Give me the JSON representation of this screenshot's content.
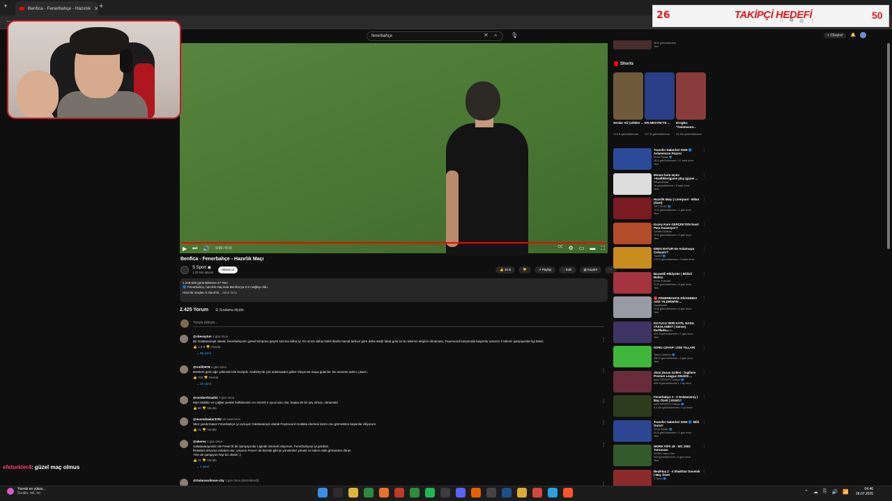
{
  "browser": {
    "tab_title": "Benfica - Fenerbahçe - Hazırlık",
    "tab_close": "✕",
    "new_tab": "+",
    "back": "←"
  },
  "youtube_header": {
    "search_value": "fenerbahçe",
    "clear_icon": "✕",
    "search_icon": "⌕",
    "mic_icon": "🎙",
    "create_label": "+ Oluştur",
    "bell_icon": "🔔"
  },
  "player": {
    "time": "0:09 / 0:15",
    "progress_fraction": 1.0,
    "play_icon": "▶",
    "next_icon": "⏭",
    "volume_icon": "🔊",
    "captions_icon": "CC",
    "settings_icon": "⚙",
    "miniplayer_icon": "▭",
    "theater_icon": "▬",
    "fullscreen_icon": "⛶"
  },
  "video": {
    "title": "Benfica - Fenerbahçe - Hazırlık Maçı",
    "channel": "S Sport",
    "channel_verified": "◉",
    "subscribers": "1,33 Mn abone",
    "subscribe_label": "Abone ol",
    "actions": [
      "👍 10 B",
      "👎",
      "↗ Paylaş",
      "↓ İndir",
      "▤ Kaydet",
      "⋯"
    ]
  },
  "description": {
    "stats": "1.228.839 görüntülenme  27 Tem",
    "line1": "🔵 Fenerbahçe, hazırlık maçında Benfica'ya 3-2 mağlup oldu.",
    "line2": "Hazırlık maçları S Sport'ta",
    "more": "...daha fazla"
  },
  "comments_header": {
    "count": "2.425 Yorum",
    "sort": "☰  Sıralama ölçütü",
    "add_placeholder": "Yorum ekleyin..."
  },
  "comments": [
    {
      "author": "@cbesaytun",
      "time": "1 gün önce",
      "text": "Bir Galatasaraylı olarak, fenerbahçenin genel temposu geçen sezona daha iyi. En azıntı daha istekli iktarla hamal tarkıve göre daha ateşli fakat golu lar bu takımın ekipleri olmaması, Feyenoord karşısında başarılar umarım 2 takımlı şampiyonlar ligi lütetz.",
      "likes": "1,5 B",
      "reply": "Yanıtla",
      "replies": "68 yanıt"
    },
    {
      "author": "@rrelif2678",
      "time": "1 gün önce",
      "text": "Benlerin gelic ağır çekimde bile bozlyok. Kadıköy'de çok anlamasam goller izleyecek maça gidenler. Bu senenin tadını çıkarın.",
      "likes": "703",
      "reply": "Yanıtla",
      "replies": "16 yanıt"
    },
    {
      "author": "@cemberkmalisi",
      "time": "1 gün önce",
      "text": "Mert Müldür ve Çağlar yeelek hollübesinin en önemli 2 oyuncusu olur, başka de bir şey olmaz, olmamalıl",
      "likes": "80",
      "reply": "Yanıtla",
      "replies": ""
    },
    {
      "author": "@mustafaakar3752",
      "time": "16 saat önce",
      "text": "Skor yazdırmasın Fenerbahçe iyi oynuyor Galatasaraylı olarak Feyenoord mutlaka elemesi lazım onu görmekten başarılar diliyorum",
      "likes": "76",
      "reply": "Yanıtla",
      "replies": ""
    },
    {
      "author": "@akeres",
      "time": "1 gün önce",
      "text": "Galatasaraymizin de Fener'di de Şampiyonlar Liginde izlemek istiyorum. Fenerbahçeyi iyi gördüm.\nRekabet olmazsa rekabet olur, umarım Fener'i de bizimki gibi iyi yönetimler yönetir ve takım esiki görüntüne döner.\nYine de şampiyon hep biz olalım :)",
      "likes": "22",
      "reply": "Yanıtla",
      "replies": "1 yanıt"
    },
    {
      "author": "@Galarasuliman-city",
      "time": "1 gün önce (düzenlendi)",
      "text": "",
      "likes": "",
      "reply": "",
      "replies": ""
    }
  ],
  "sidebar": {
    "top_partial": "58 B görüntülenme\nYeni",
    "shorts_label": "Shorts",
    "shorts": [
      {
        "title": "Serdar Ali Çelikler ...",
        "views": "210 B görüntülenme",
        "color": "#6f5a3a"
      },
      {
        "title": "EN-NESYRI'YE ...",
        "views": "127 B görüntülenme",
        "color": "#2a3e88"
      },
      {
        "title": "Drogba: \"Galatasara...",
        "views": "24 Mn görüntülenme",
        "color": "#8a3b3b"
      }
    ],
    "items": [
      {
        "title": "Transfer Haberleri 2026 🔵 Aslanımızın Pazarı!",
        "channel": "Emre Fiyalkı 🔵",
        "meta": "48 B görüntülenme • 17 saat önce",
        "badge": "Yeni",
        "color": "#2b4a9a"
      },
      {
        "title": "Mouse kutu açımı +özelliklerigame play (game ...",
        "channel": "FiBaxxMoba",
        "meta": "16 görüntülenme • 8 saat önce",
        "badge": "Yeni",
        "color": "#dcdcdc"
      },
      {
        "title": "Hazırlık Maçı | Liverpool - Milan (Özet)",
        "channel": "TRT SPOR 🔵",
        "meta": "72 B görüntülenme • 1 gün önce",
        "badge": "Yeni",
        "color": "#7a1b22"
      },
      {
        "title": "Kuzey Kore GERÇEKTEN Nasıl Para Kazanıyor?",
        "channel": "Geldim Dinkum",
        "meta": "72 B görüntülenme • 2 gün önce",
        "badge": "Yeni",
        "color": "#b44b2a"
      },
      {
        "title": "ENES BATUR Ne Anlatmaya Çalışıyor?",
        "channel": "YouMo 🔵",
        "meta": "170 B görüntülenme • 3 hafta önce",
        "badge": "",
        "color": "#c98c1e"
      },
      {
        "title": "Barankli Hikâyeler | Bitlisli Baltsu",
        "channel": "Emre Köklüsel",
        "meta": "33 B görüntülenme • 6 gün önce",
        "badge": "Yeni",
        "color": "#a53340"
      },
      {
        "title": "🔴 FENERBAHCE DİVANINDA AZİZ YILDIRIM'IN ...",
        "channel": "HandSantK",
        "meta": "23 B görüntülenme • 6 gün önce",
        "badge": "Yeni",
        "color": "#9a9aa5"
      },
      {
        "title": "KUYUCU SERİ KATİL NASIL YAKALANDI? | Sansej Kartlıolu...",
        "channel": "Sansej Kartlıolu",
        "meta": "204 B görüntülenme • 7 gün önce",
        "badge": "Yeni",
        "color": "#3e3564"
      },
      {
        "title": "SORU CEVAP: LİSE YILLARI",
        "channel": "Tanrım Ankhon 🔵",
        "meta": "298 B görüntülenme • 4 gün önce",
        "badge": "Yeni",
        "color": "#3fb73a"
      },
      {
        "title": "Jhon Duran Golleri - İngiltere Premier League 2024/25 ...",
        "channel": "beIN SPORTS Türkiye 🔵",
        "meta": "495 B görüntülenme • 1 ay önce",
        "badge": "",
        "color": "#6a2b3a"
      },
      {
        "title": "Fenerbahçe 2 - 0 Galatasaray | Maç Özeti | 2016/17",
        "channel": "beIN SPORTS Türkiye 🔵",
        "meta": "9,4 Mn görüntülenme • 4 yıl önce",
        "badge": "",
        "color": "#2e3c1e"
      },
      {
        "title": "Transfer Haberleri 2026 🔵 Milli Gurur!",
        "channel": "Emre Fiyalkı 🔵",
        "meta": "94 B görüntülenme • 1 gün önce",
        "badge": "Yeni",
        "color": "#2c4694"
      },
      {
        "title": "WORK FIFA 16 - WC 2002 Turnuvası",
        "channel": "WORK Yapın Kim",
        "meta": "943 görüntülenme • 5 gün önce",
        "badge": "Yeni",
        "color": "#335a2a"
      },
      {
        "title": "Beşiktaş 2 - 4 Shakhtar Donetsk | Maç Özeti",
        "channel": "S Sport 🔵",
        "meta": "",
        "badge": "",
        "color": "#8a2a2a"
      }
    ]
  },
  "overlay_goal": {
    "current": "26",
    "label": "TAKİPÇİ HEDEFİ",
    "target": "50"
  },
  "chat": {
    "user": "efeturkler4",
    "message": ": güzel maç olmus"
  },
  "taskbar": {
    "weather_line1": "Yarınki en yükse...",
    "weather_line2": "Sıcaklı. rek. kır.",
    "time": "04:46",
    "date": "28.07.2025",
    "tray": [
      "⌃",
      "☁",
      "⎘",
      "🔊",
      "📶"
    ],
    "apps": [
      {
        "name": "windows-start",
        "color": "#3a8ee6"
      },
      {
        "name": "search",
        "color": "#2c2c2c"
      },
      {
        "name": "file-explorer",
        "color": "#e0b43a"
      },
      {
        "name": "app-green",
        "color": "#2b8a3e"
      },
      {
        "name": "app-orange",
        "color": "#e8702a"
      },
      {
        "name": "app-red",
        "color": "#c0392b"
      },
      {
        "name": "xbox",
        "color": "#2e8b3a"
      },
      {
        "name": "spotify",
        "color": "#1db954"
      },
      {
        "name": "obs",
        "color": "#3c3c3c"
      },
      {
        "name": "discord",
        "color": "#5865f2"
      },
      {
        "name": "app-firefox",
        "color": "#e66000"
      },
      {
        "name": "app-terminal",
        "color": "#444"
      },
      {
        "name": "steam",
        "color": "#1b4f8a"
      },
      {
        "name": "chrome",
        "color": "#dbab33"
      },
      {
        "name": "chrome-2",
        "color": "#d34a3a"
      },
      {
        "name": "telegram",
        "color": "#2aa1de"
      },
      {
        "name": "brave",
        "color": "#fb542b"
      }
    ]
  },
  "colors": {
    "accent_red": "#ff0000",
    "link_blue": "#3ea6ff"
  }
}
